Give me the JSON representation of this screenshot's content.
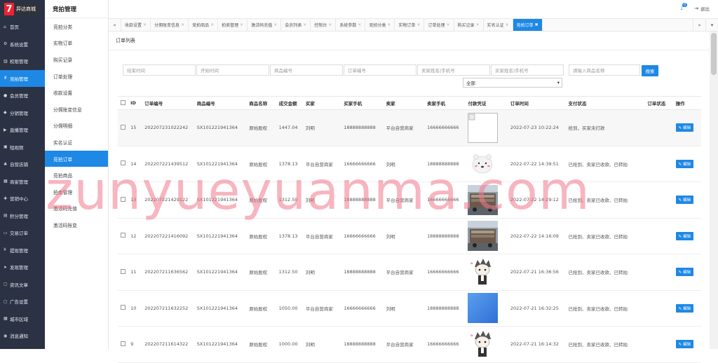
{
  "brand": {
    "logo_char": "7",
    "logo_text": "异达商城"
  },
  "leftnav": [
    {
      "icon": "home-icon",
      "glyph": "⌂",
      "label": "首页"
    },
    {
      "icon": "gear-icon",
      "glyph": "⚙",
      "label": "系统设置"
    },
    {
      "icon": "chart-icon",
      "glyph": "▥",
      "label": "权限管理"
    },
    {
      "icon": "auction-icon",
      "glyph": "♜",
      "label": "竞拍管理",
      "active": true
    },
    {
      "icon": "user-icon",
      "glyph": "●",
      "label": "会员管理"
    },
    {
      "icon": "share-icon",
      "glyph": "◆",
      "label": "分销管理"
    },
    {
      "icon": "live-icon",
      "glyph": "▶",
      "label": "直播管理"
    },
    {
      "icon": "video-icon",
      "glyph": "▣",
      "label": "短视频"
    },
    {
      "icon": "store-icon",
      "glyph": "♣",
      "label": "自营店铺"
    },
    {
      "icon": "merchant-icon",
      "glyph": "▦",
      "label": "商家管理"
    },
    {
      "icon": "marketing-icon",
      "glyph": "✚",
      "label": "营销中心"
    },
    {
      "icon": "points-icon",
      "glyph": "▤",
      "label": "积分管理"
    },
    {
      "icon": "order-icon",
      "glyph": "▭",
      "label": "交易订单"
    },
    {
      "icon": "yen-icon",
      "glyph": "¥",
      "label": "提现管理"
    },
    {
      "icon": "send-icon",
      "glyph": "➤",
      "label": "发现管理"
    },
    {
      "icon": "article-icon",
      "glyph": "▢",
      "label": "资讯文章"
    },
    {
      "icon": "ad-icon",
      "glyph": "▢",
      "label": "广告设置"
    },
    {
      "icon": "city-icon",
      "glyph": "▦",
      "label": "城市区域"
    },
    {
      "icon": "message-icon",
      "glyph": "◉",
      "label": "消息通知"
    }
  ],
  "subnav": {
    "title": "竞拍管理",
    "items": [
      "竞拍分类",
      "实物订单",
      "购买记录",
      "订单处理",
      "收款设置",
      "分佣账变信息",
      "分佣明细",
      "实名认证",
      "竞拍订单",
      "竞拍商品",
      "拍卖管理",
      "激活码充值",
      "激活码账变"
    ],
    "active_index": 8
  },
  "topbar": {
    "badge": "0",
    "logout": "退出"
  },
  "tabs": [
    {
      "label": "收款设置"
    },
    {
      "label": "分佣账变信息"
    },
    {
      "label": "竞拍商品"
    },
    {
      "label": "拍卖管理"
    },
    {
      "label": "激活码充值"
    },
    {
      "label": "会员列表"
    },
    {
      "label": "控制台"
    },
    {
      "label": "系统参数"
    },
    {
      "label": "竞拍分类"
    },
    {
      "label": "实物订单"
    },
    {
      "label": "订单处理"
    },
    {
      "label": "购买记录"
    },
    {
      "label": "实名认证"
    },
    {
      "label": "竞拍订单",
      "active": true
    }
  ],
  "page_title": "订单列表",
  "filters": {
    "end_time": "结束时间",
    "start_time": "开始时间",
    "product_no": "商品编号",
    "order_no": "订单编号",
    "seller": "卖家姓名|手机号",
    "buyer": "买家姓名|手机号",
    "product_name": "请输入商品名称",
    "search": "搜索",
    "status_select": "全部"
  },
  "table": {
    "headers": [
      "ID",
      "订单编号",
      "商品编号",
      "商品名称",
      "成交金额",
      "买家",
      "买家手机",
      "卖家",
      "卖家手机",
      "付款凭证",
      "订单时间",
      "支付状态",
      "订单状态",
      "操作"
    ],
    "edit_label": "编辑",
    "rows": [
      {
        "id": "15",
        "order_no": "202207231022242",
        "product_no": "SX101221941364",
        "name": "原始股权",
        "amount": "1447.04",
        "buyer": "刘明",
        "buyer_phone": "18888888888",
        "seller": "平台自营商家",
        "seller_phone": "16666666666",
        "proof": "broken",
        "time": "2022-07-23 10:22:24",
        "pay_status": "抢到，买家未打款",
        "order_status": ""
      },
      {
        "id": "14",
        "order_no": "202207221439512",
        "product_no": "SX101221941364",
        "name": "原始股权",
        "amount": "1378.13",
        "buyer": "平台自营商家",
        "buyer_phone": "16666666666",
        "seller": "刘明",
        "seller_phone": "18888888888",
        "proof": "bear",
        "time": "2022-07-22 14:39:51",
        "pay_status": "已抢到、卖家已收款、已转拍",
        "order_status": ""
      },
      {
        "id": "13",
        "order_no": "202207221429122",
        "product_no": "SX101221941364",
        "name": "原始股权",
        "amount": "1312.50",
        "buyer": "刘明",
        "buyer_phone": "18888888888",
        "seller": "平台自营商家",
        "seller_phone": "16666666666",
        "proof": "truck",
        "time": "2022-07-22 14:29:12",
        "pay_status": "已抢到、卖家已收款、已转拍",
        "order_status": ""
      },
      {
        "id": "12",
        "order_no": "202207221416092",
        "product_no": "SX101221941364",
        "name": "原始股权",
        "amount": "1378.13",
        "buyer": "平台自营商家",
        "buyer_phone": "16666666666",
        "seller": "刘明",
        "seller_phone": "18888888888",
        "proof": "truck",
        "time": "2022-07-22 14:16:09",
        "pay_status": "已抢到、卖家已收款、已转拍",
        "order_status": ""
      },
      {
        "id": "11",
        "order_no": "202207211636562",
        "product_no": "SX101221941364",
        "name": "原始股权",
        "amount": "1312.50",
        "buyer": "刘明",
        "buyer_phone": "18888888888",
        "seller": "平台自营商家",
        "seller_phone": "16666666666",
        "proof": "anime",
        "time": "2022-07-21 16:36:56",
        "pay_status": "已抢到、卖家已收款、已转拍",
        "order_status": ""
      },
      {
        "id": "10",
        "order_no": "202207211632252",
        "product_no": "SX101221941364",
        "name": "原始股权",
        "amount": "1050.00",
        "buyer": "平台自营商家",
        "buyer_phone": "16666666666",
        "seller": "刘明",
        "seller_phone": "18888888888",
        "proof": "blue",
        "time": "2022-07-21 16:32:25",
        "pay_status": "已抢到、卖家已收款、已转拍",
        "order_status": ""
      },
      {
        "id": "9",
        "order_no": "202207211614322",
        "product_no": "SX101221941364",
        "name": "原始股权",
        "amount": "1000.00",
        "buyer": "刘明",
        "buyer_phone": "18888888888",
        "seller": "平台自营商家",
        "seller_phone": "16666666666",
        "proof": "anime",
        "time": "2022-07-21 16:14:32",
        "pay_status": "已抢到、卖家已收款、已转拍",
        "order_status": ""
      }
    ]
  },
  "watermark": "zunyueyuanma.com"
}
